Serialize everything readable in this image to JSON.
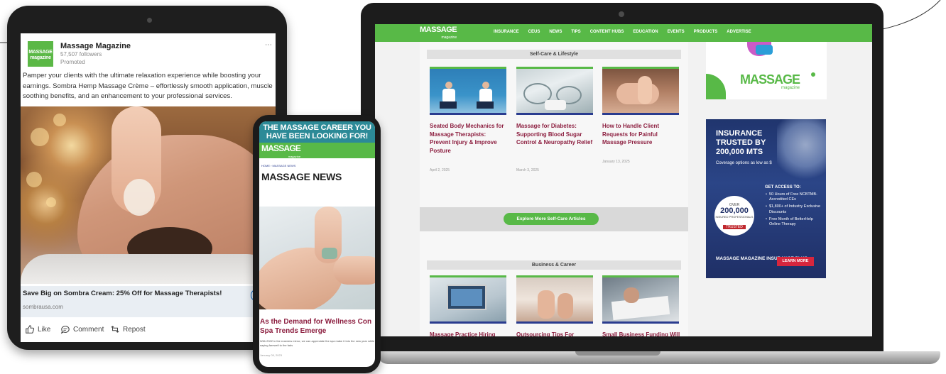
{
  "tablet": {
    "linkedin_ad": {
      "company": "Massage Magazine",
      "logo_text": "MASSAGE magazine",
      "followers": "57,507 followers",
      "promoted": "Promoted",
      "body": "Pamper your clients with the ultimate relaxation experience while boosting your earnings. Sombra Hemp Massage Crème – effortlessly smooth application, muscle soothing benefits, and an enhancement to your professional services.",
      "cta_title": "Save Big on Sombra Cream: 25% Off for Massage Therapists!",
      "cta_url": "sombrausa.com",
      "cta_button": "S",
      "actions": [
        "Like",
        "Comment",
        "Repost"
      ]
    }
  },
  "laptop": {
    "site": {
      "logo": "MASSAGE",
      "logo_sub": "magazine",
      "nav": [
        "INSURANCE",
        "CEUS",
        "NEWS",
        "TIPS",
        "CONTENT HUBS",
        "EDUCATION",
        "EVENTS",
        "PRODUCTS",
        "ADVERTISE"
      ],
      "sections": [
        {
          "title": "Self-Care & Lifestyle",
          "cards": [
            {
              "title": "Seated Body Mechanics for Massage Therapists: Prevent Injury & Improve Posture",
              "date": "April 2, 2025"
            },
            {
              "title": "Massage for Diabetes: Supporting Blood Sugar Control & Neuropathy Relief",
              "date": "March 3, 2025"
            },
            {
              "title": "How to Handle Client Requests for Painful Massage Pressure",
              "date": "January 13, 2025"
            }
          ],
          "button": "Explore More Self-Care Articles"
        },
        {
          "title": "Business & Career",
          "cards": [
            {
              "title": "Massage Practice Hiring Tips"
            },
            {
              "title": "Outsourcing Tips For Massage Therapists"
            },
            {
              "title": "Small Business Funding Will Help Grow Your Massage Practice"
            }
          ]
        }
      ],
      "sidebar": {
        "logo": "MASSAGE",
        "logo_sub": "magazine",
        "ad": {
          "headline": [
            "INSURANCE",
            "TRUSTED BY",
            "200,000 MTS"
          ],
          "subline": "Coverage options as low as $",
          "badge_over": "OVER",
          "badge_number": "200,000",
          "badge_label": "INSURED PROFESSIONALS",
          "badge_ribbon": "TRUSTED",
          "access_title": "GET ACCESS TO:",
          "benefits": [
            "50 Hours of Free NCBTMB-Accredited CEs",
            "$1,800+ of Industry Exclusive Discounts",
            "Free Month of BetterHelp Online Therapy"
          ],
          "brand": "MASSAGE MAGAZINE INSURANCE PLUS",
          "cta": "LEARN MORE"
        }
      }
    }
  },
  "phone": {
    "banner": "THE MASSAGE CAREER YOU HAVE BEEN LOOKING FOR!",
    "logo": "MASSAGE",
    "logo_sub": "magazine",
    "breadcrumb": "HOME › MASSAGE NEWS",
    "page_title": "MASSAGE NEWS",
    "article": {
      "headline": "As the Demand for Wellness Con Spa Trends Emerge",
      "excerpt": "With 2022 in the rearview mirror, we can appreciate the spa make it into the new year while saying farewell to the fads",
      "date": "January 05, 2023"
    }
  },
  "colors": {
    "brand_green": "#58b947",
    "headline_maroon": "#8c1e3f",
    "navy": "#2a3c8f",
    "linkedin_blue": "#0a66c2"
  }
}
